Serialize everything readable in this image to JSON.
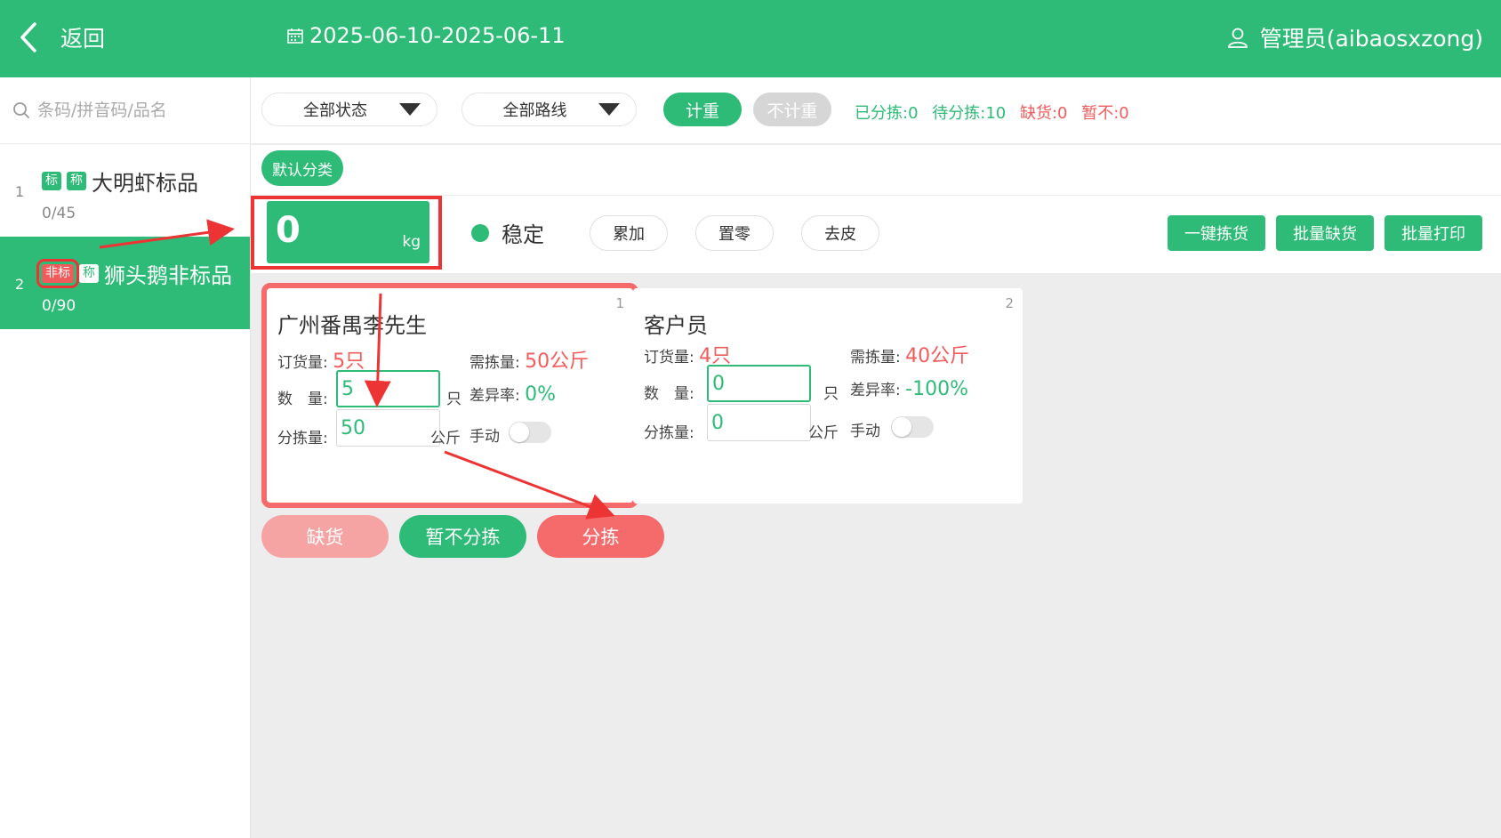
{
  "topbar": {
    "back_label": "返回",
    "date_range": "2025-06-10-2025-06-11",
    "user": "管理员(aibaosxzong)"
  },
  "sidebar": {
    "search_placeholder": "条码/拼音码/品名",
    "items": [
      {
        "index": "1",
        "tags": [
          "标",
          "称"
        ],
        "name": "大明虾标品",
        "count": "0/45",
        "active": false
      },
      {
        "index": "2",
        "tags": [
          "非标",
          "称"
        ],
        "name": "狮头鹅非标品",
        "count": "0/90",
        "active": true
      }
    ]
  },
  "filters": {
    "status": "全部状态",
    "route": "全部路线",
    "weigh": "计重",
    "no_weigh": "不计重",
    "stats": {
      "sorted": "已分拣:0",
      "pending": "待分拣:10",
      "short": "缺货:0",
      "hold": "暂不:0"
    }
  },
  "category": "默认分类",
  "scale": {
    "value": "0",
    "unit": "kg",
    "stable": "稳定",
    "buttons": [
      "累加",
      "置零",
      "去皮"
    ],
    "actions": [
      "一键拣货",
      "批量缺货",
      "批量打印"
    ]
  },
  "cards": [
    {
      "num": "1",
      "customer": "广州番禺李先生",
      "order_label": "订货量:",
      "order_value": "5只",
      "need_label": "需拣量:",
      "need_value": "50公斤",
      "qty_label": "数　量:",
      "qty_value": "5",
      "qty_unit": "只",
      "diff_label": "差异率:",
      "diff_value": "0%",
      "sort_label": "分拣量:",
      "sort_value": "50",
      "sort_unit": "公斤",
      "manual_label": "手动",
      "manual_on": false
    },
    {
      "num": "2",
      "customer": "客户员",
      "order_label": "订货量:",
      "order_value": "4只",
      "need_label": "需拣量:",
      "need_value": "40公斤",
      "qty_label": "数　量:",
      "qty_value": "0",
      "qty_unit": "只",
      "diff_label": "差异率:",
      "diff_value": "-100%",
      "sort_label": "分拣量:",
      "sort_value": "0",
      "sort_unit": "公斤",
      "manual_label": "手动",
      "manual_on": false
    }
  ],
  "card_actions": {
    "short": "缺货",
    "hold": "暂不分拣",
    "sort": "分拣"
  },
  "colors": {
    "brand_green": "#2dbb77",
    "alert_red": "#f25b5b",
    "annotation_red": "#ec3434"
  }
}
